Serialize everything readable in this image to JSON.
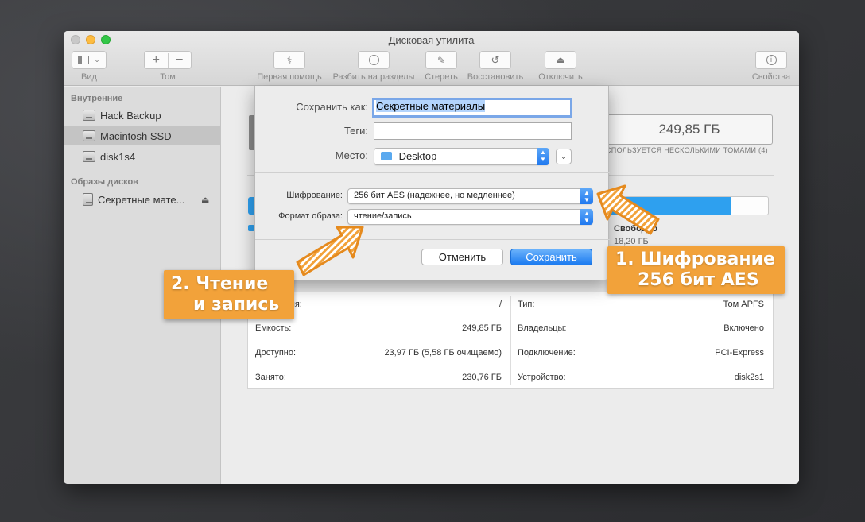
{
  "window": {
    "title": "Дисковая утилита"
  },
  "toolbar": {
    "view_label": "Вид",
    "volume_label": "Том",
    "first_aid_label": "Первая помощь",
    "partition_label": "Разбить на разделы",
    "erase_label": "Стереть",
    "restore_label": "Восстановить",
    "unmount_label": "Отключить",
    "info_label": "Свойства"
  },
  "sidebar": {
    "internal_header": "Внутренние",
    "internal_items": [
      "Hack Backup",
      "Macintosh SSD",
      "disk1s4"
    ],
    "images_header": "Образы дисков",
    "image_items": [
      "Секретные мате..."
    ]
  },
  "main": {
    "capacity": "249,85 ГБ",
    "shared_note": "СПОЛЬЗУЕТСЯ НЕСКОЛЬКИМИ ТОМАМИ (4)",
    "free_label": "Свободно",
    "free_value": "18,20 ГБ",
    "usage_fraction": 0.77,
    "info_left": [
      {
        "k": "дключения:",
        "v": "/"
      },
      {
        "k": "Емкость:",
        "v": "249,85 ГБ"
      },
      {
        "k": "Доступно:",
        "v": "23,97 ГБ (5,58 ГБ очищаемо)"
      },
      {
        "k": "Занято:",
        "v": "230,76 ГБ"
      }
    ],
    "info_right": [
      {
        "k": "Тип:",
        "v": "Том APFS"
      },
      {
        "k": "Владельцы:",
        "v": "Включено"
      },
      {
        "k": "Подключение:",
        "v": "PCI-Express"
      },
      {
        "k": "Устройство:",
        "v": "disk2s1"
      }
    ]
  },
  "sheet": {
    "save_as_label": "Сохранить как:",
    "save_as_value": "Секретные материалы",
    "tags_label": "Теги:",
    "tags_value": "",
    "location_label": "Место:",
    "location_value": "Desktop",
    "encryption_label": "Шифрование:",
    "encryption_value": "256 бит AES (надежнее, но медленнее)",
    "format_label": "Формат образа:",
    "format_value": "чтение/запись",
    "cancel_label": "Отменить",
    "save_label": "Сохранить"
  },
  "callouts": {
    "one_line1": "1. Шифрование",
    "one_line2": "256 бит AES",
    "two_line1": "2. Чтение",
    "two_line2": "и запись"
  },
  "colors": {
    "accent": "#1c7bf0",
    "callout": "#f2a23a",
    "usage_bar": "#2ea0ef"
  }
}
